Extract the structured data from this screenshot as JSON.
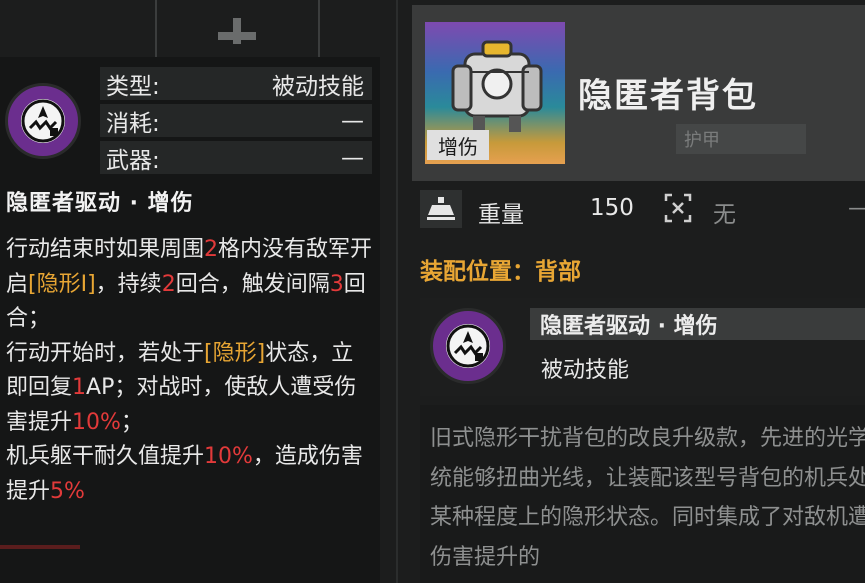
{
  "left_panel": {
    "info": [
      {
        "key": "类型:",
        "value": "被动技能"
      },
      {
        "key": "消耗:",
        "value": "—"
      },
      {
        "key": "武器:",
        "value": "—"
      }
    ],
    "title": "隐匿者驱动 · 增伤",
    "desc": {
      "p1": "行动结束时如果周围",
      "n1": "2",
      "p2": "格内没有敌军开启",
      "tag1": "[隐形Ⅰ]",
      "p3": "，持续",
      "n2": "2",
      "p4": "回合，触发间隔",
      "n3": "3",
      "p5": "回合；",
      "p6": "行动开始时，若处于",
      "tag2": "[隐形]",
      "p7": "状态，立即回复",
      "n4": "1",
      "p8": "AP；对战时，使敌人遭受伤害提升",
      "n5": "10%",
      "p9": "；",
      "p10": "机兵躯干耐久值提升",
      "n6": "10%",
      "p11": "，造成伤害提升",
      "n7": "5%"
    }
  },
  "right_panel": {
    "portrait_tag": "增伤",
    "item_name": "隐匿者背包",
    "ghost_label": "护甲",
    "stats": {
      "weight_label": "重量",
      "weight_value": "150",
      "target_value": "无",
      "extra": "—"
    },
    "equip_position": "装配位置：背部",
    "skill_card": {
      "title": "隐匿者驱动 · 增伤",
      "type": "被动技能"
    },
    "description": "旧式隐形干扰背包的改良升级款，先进的光学系统能够扭曲光线，让装配该型号背包的机兵处于某种程度上的隐形状态。同时集成了对敌机遭受伤害提升的"
  },
  "colors": {
    "accent_gold": "#e8a634",
    "accent_red": "#e23a3a",
    "icon_purple": "#6b2e8e"
  }
}
